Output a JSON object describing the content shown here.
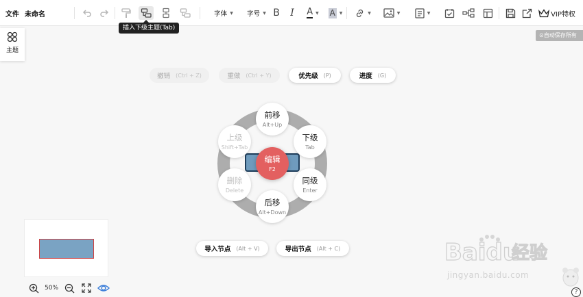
{
  "toolbar": {
    "file_menu": "文件",
    "doc_title": "未命名",
    "font_family": "字体",
    "font_size": "字号",
    "bold": "B",
    "italic": "I",
    "font_color": "A",
    "highlight": "A",
    "vip_label": "VIP特权"
  },
  "tooltip": "插入下级主题(Tab)",
  "side_panel": {
    "theme_label": "主题"
  },
  "autosave": "自动保存所有",
  "shortcuts": {
    "undo": {
      "label": "撤销",
      "key": "(Ctrl + Z)"
    },
    "redo": {
      "label": "重做",
      "key": "(Ctrl + Y)"
    },
    "priority": {
      "label": "优先级",
      "key": "(P)"
    },
    "progress": {
      "label": "进度",
      "key": "(G)"
    },
    "import_node": {
      "label": "导入节点",
      "key": "(Alt + V)"
    },
    "export_node": {
      "label": "导出节点",
      "key": "(Alt + C)"
    }
  },
  "radial_menu": {
    "center": {
      "label": "编辑",
      "key": "F2"
    },
    "move_up": {
      "label": "前移",
      "key": "Alt+Up"
    },
    "child": {
      "label": "下级",
      "key": "Tab"
    },
    "sibling": {
      "label": "同级",
      "key": "Enter"
    },
    "move_down": {
      "label": "后移",
      "key": "Alt+Down"
    },
    "delete": {
      "label": "删除",
      "key": "Delete"
    },
    "parent": {
      "label": "上级",
      "key": "Shift+Tab"
    }
  },
  "zoom": {
    "value": "50%"
  },
  "watermark": {
    "brand": "Baidu经验",
    "url": "jingyan.baidu.com"
  },
  "help": "?",
  "colors": {
    "accent_red": "#e36060",
    "node_fill": "#6f9bbd",
    "node_border": "#1e3d5a",
    "ring": "#adadad",
    "eye_icon": "#3d7fd9"
  }
}
